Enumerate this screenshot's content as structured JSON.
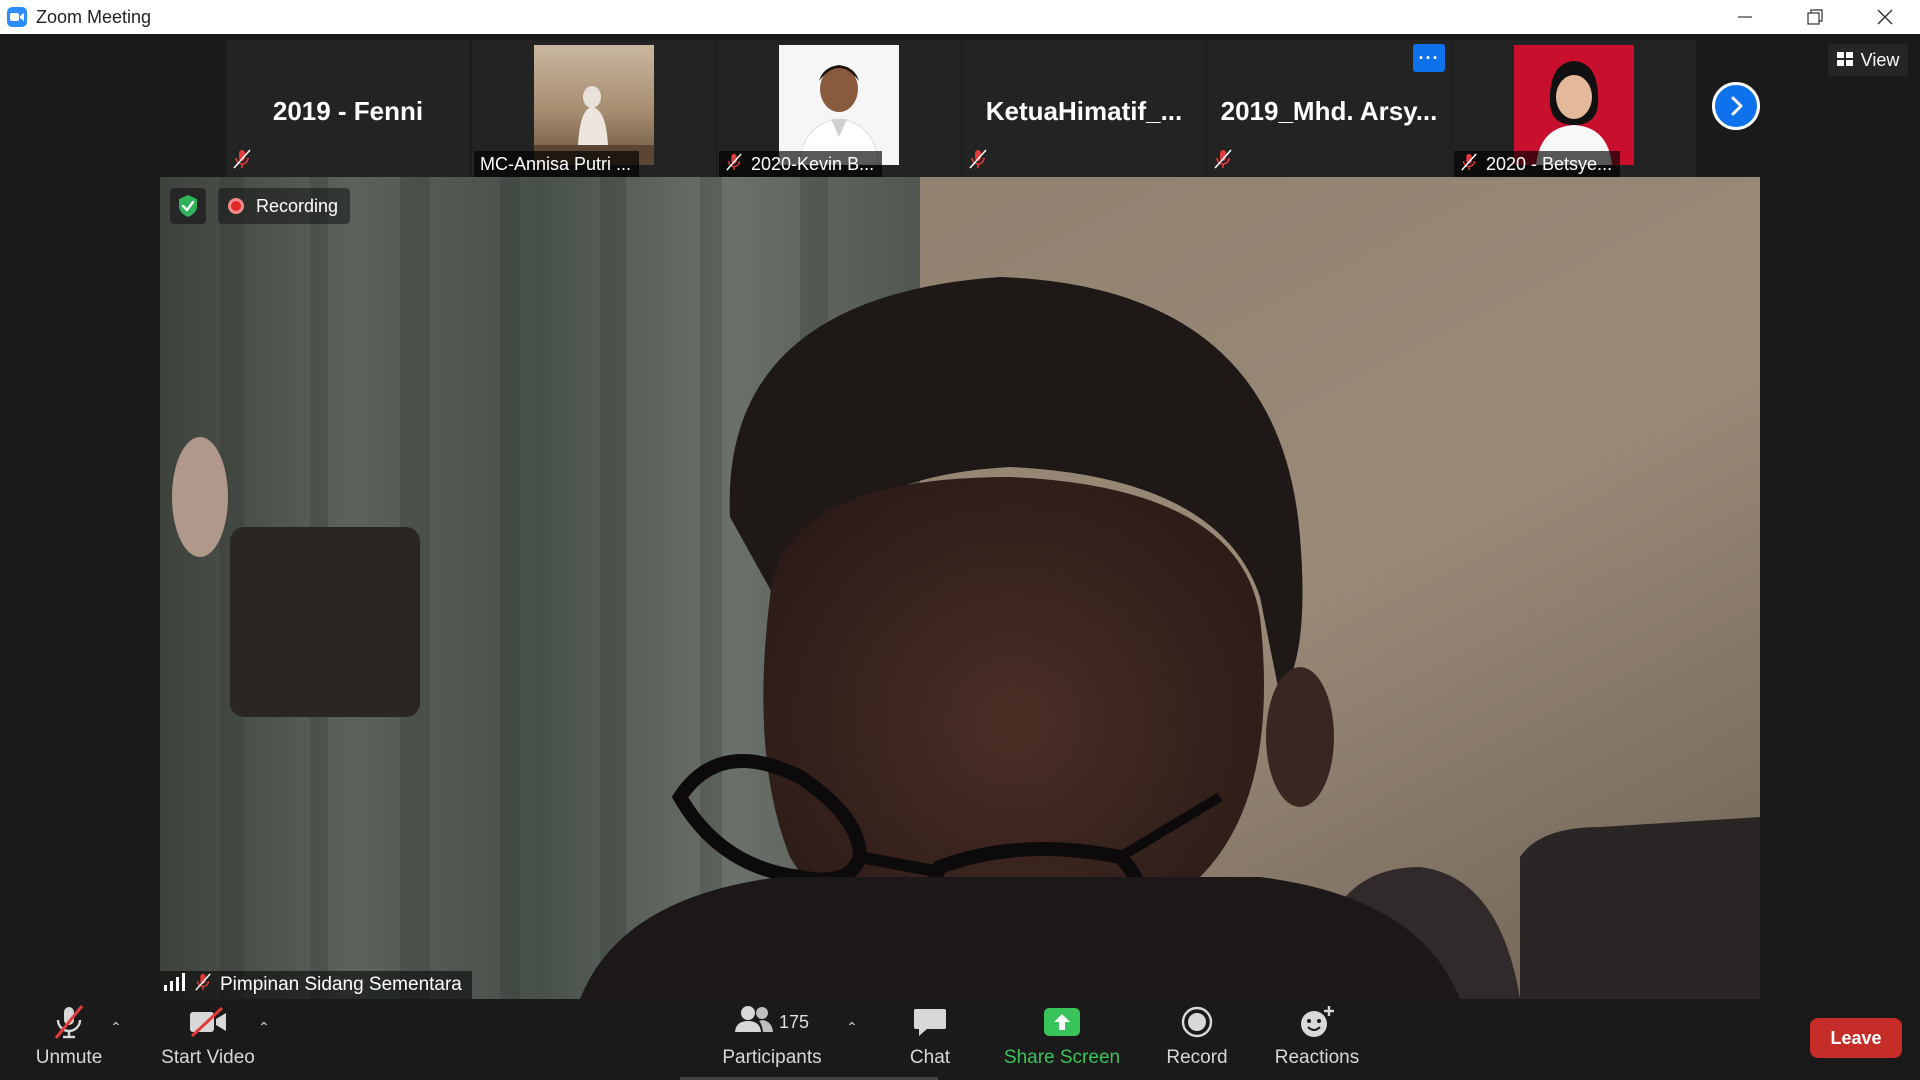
{
  "window": {
    "title": "Zoom Meeting"
  },
  "strip": {
    "tiles": [
      {
        "name": "2019 - Fenni",
        "type": "name",
        "muted": true
      },
      {
        "name": "MC-Annisa Putri ...",
        "type": "video",
        "muted": false
      },
      {
        "name": "2020-Kevin B...",
        "type": "video",
        "muted": true
      },
      {
        "name": "KetuaHimatif_...",
        "type": "name",
        "muted": true
      },
      {
        "name": "2019_Mhd.  Arsy...",
        "type": "name",
        "muted": true
      },
      {
        "name": "2020 - Betsye...",
        "type": "video",
        "muted": true
      }
    ],
    "more_dots": "···",
    "view_label": "View"
  },
  "main": {
    "recording_label": "Recording",
    "speaker_name": "Pimpinan Sidang Sementara"
  },
  "toolbar": {
    "unmute": "Unmute",
    "start_video": "Start Video",
    "participants": "Participants",
    "participants_count": "175",
    "chat": "Chat",
    "share_screen": "Share Screen",
    "record": "Record",
    "reactions": "Reactions",
    "leave": "Leave"
  },
  "colors": {
    "accent": "#0e72ed",
    "leave": "#c62c28",
    "share": "#38c35b",
    "muted_icon": "#e23b3b"
  },
  "icons": [
    "zoom-app-icon",
    "minimize-icon",
    "restore-icon",
    "close-icon",
    "muted-mic-icon",
    "chevron-right-icon",
    "grid-icon",
    "shield-icon",
    "record-dot-icon",
    "signal-icon",
    "mic-off-icon",
    "video-off-icon",
    "participants-icon",
    "chat-icon",
    "share-screen-icon",
    "record-icon",
    "reactions-icon",
    "caret-up-icon"
  ]
}
